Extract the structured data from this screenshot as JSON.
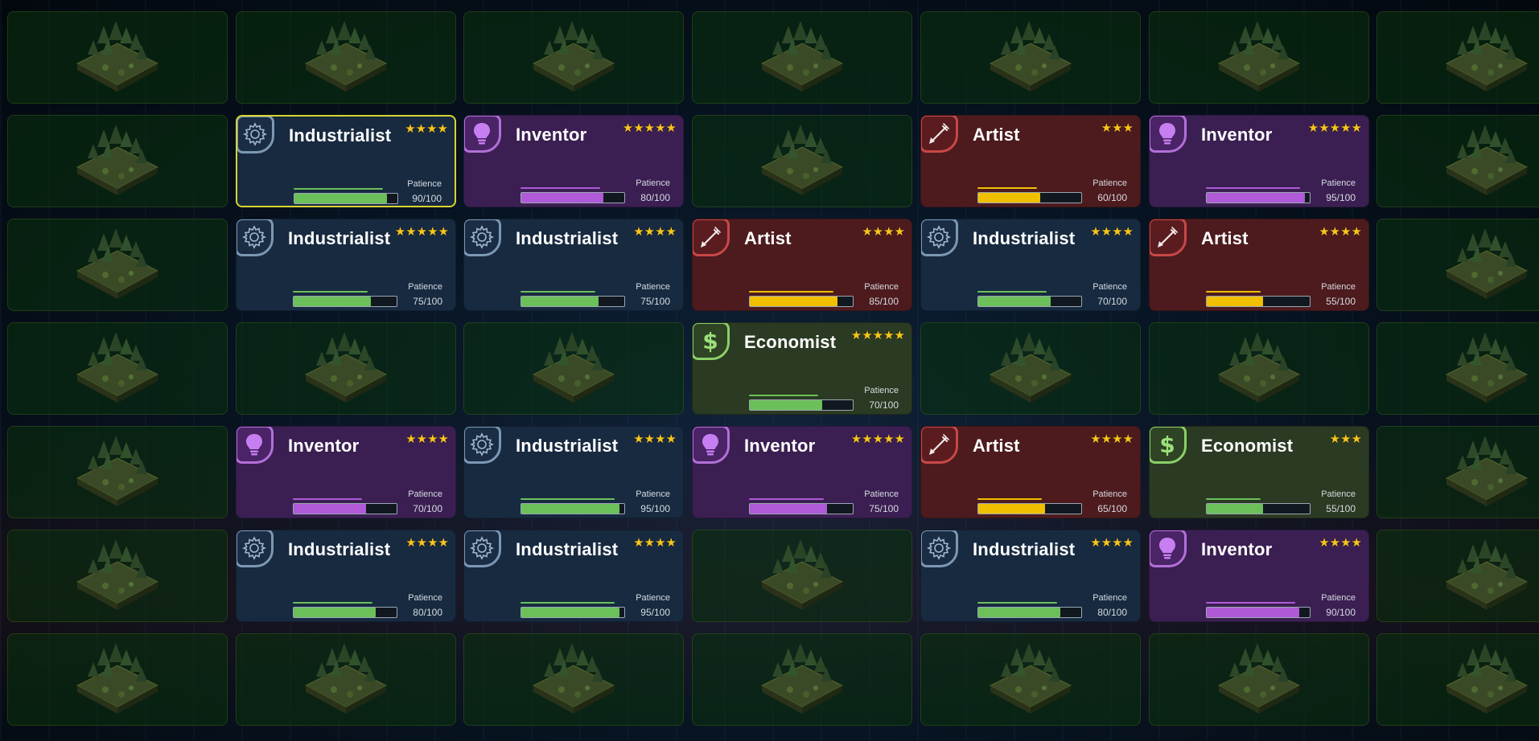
{
  "labels": {
    "patience": "Patience"
  },
  "colors": {
    "bar_fill": {
      "industrialist": "#6cc05a",
      "economist": "#6cc05a",
      "inventor": "#b05ad8",
      "artist": "#f0c000"
    },
    "star": "#f7c51e"
  },
  "grid": {
    "rows": 7,
    "cols": 7,
    "empty_tile_icon": "forest-tile-icon",
    "cards": [
      {
        "row": 1,
        "col": 1,
        "role": "Industrialist",
        "type": "industrialist",
        "icon": "gear-icon",
        "stars": "★★★★",
        "patience": 90,
        "patience_text": "90/100",
        "selected": true
      },
      {
        "row": 1,
        "col": 2,
        "role": "Inventor",
        "type": "inventor",
        "icon": "lightbulb-icon",
        "stars": "★★★★★",
        "patience": 80,
        "patience_text": "80/100"
      },
      {
        "row": 1,
        "col": 4,
        "role": "Artist",
        "type": "artist",
        "icon": "paintbrush-icon",
        "stars": "★★★",
        "patience": 60,
        "patience_text": "60/100"
      },
      {
        "row": 1,
        "col": 5,
        "role": "Inventor",
        "type": "inventor",
        "icon": "lightbulb-icon",
        "stars": "★★★★★",
        "patience": 95,
        "patience_text": "95/100"
      },
      {
        "row": 2,
        "col": 1,
        "role": "Industrialist",
        "type": "industrialist",
        "icon": "gear-icon",
        "stars": "★★★★★",
        "patience": 75,
        "patience_text": "75/100"
      },
      {
        "row": 2,
        "col": 2,
        "role": "Industrialist",
        "type": "industrialist",
        "icon": "gear-icon",
        "stars": "★★★★",
        "patience": 75,
        "patience_text": "75/100"
      },
      {
        "row": 2,
        "col": 3,
        "role": "Artist",
        "type": "artist",
        "icon": "paintbrush-icon",
        "stars": "★★★★",
        "patience": 85,
        "patience_text": "85/100"
      },
      {
        "row": 2,
        "col": 4,
        "role": "Industrialist",
        "type": "industrialist",
        "icon": "gear-icon",
        "stars": "★★★★",
        "patience": 70,
        "patience_text": "70/100"
      },
      {
        "row": 2,
        "col": 5,
        "role": "Artist",
        "type": "artist",
        "icon": "paintbrush-icon",
        "stars": "★★★★",
        "patience": 55,
        "patience_text": "55/100"
      },
      {
        "row": 3,
        "col": 3,
        "role": "Economist",
        "type": "economist",
        "icon": "dollar-icon",
        "stars": "★★★★★",
        "patience": 70,
        "patience_text": "70/100"
      },
      {
        "row": 4,
        "col": 1,
        "role": "Inventor",
        "type": "inventor",
        "icon": "lightbulb-icon",
        "stars": "★★★★",
        "patience": 70,
        "patience_text": "70/100"
      },
      {
        "row": 4,
        "col": 2,
        "role": "Industrialist",
        "type": "industrialist",
        "icon": "gear-icon",
        "stars": "★★★★",
        "patience": 95,
        "patience_text": "95/100"
      },
      {
        "row": 4,
        "col": 3,
        "role": "Inventor",
        "type": "inventor",
        "icon": "lightbulb-icon",
        "stars": "★★★★★",
        "patience": 75,
        "patience_text": "75/100"
      },
      {
        "row": 4,
        "col": 4,
        "role": "Artist",
        "type": "artist",
        "icon": "paintbrush-icon",
        "stars": "★★★★",
        "patience": 65,
        "patience_text": "65/100"
      },
      {
        "row": 4,
        "col": 5,
        "role": "Economist",
        "type": "economist",
        "icon": "dollar-icon",
        "stars": "★★★",
        "patience": 55,
        "patience_text": "55/100"
      },
      {
        "row": 5,
        "col": 1,
        "role": "Industrialist",
        "type": "industrialist",
        "icon": "gear-icon",
        "stars": "★★★★",
        "patience": 80,
        "patience_text": "80/100"
      },
      {
        "row": 5,
        "col": 2,
        "role": "Industrialist",
        "type": "industrialist",
        "icon": "gear-icon",
        "stars": "★★★★",
        "patience": 95,
        "patience_text": "95/100"
      },
      {
        "row": 5,
        "col": 4,
        "role": "Industrialist",
        "type": "industrialist",
        "icon": "gear-icon",
        "stars": "★★★★",
        "patience": 80,
        "patience_text": "80/100"
      },
      {
        "row": 5,
        "col": 5,
        "role": "Inventor",
        "type": "inventor",
        "icon": "lightbulb-icon",
        "stars": "★★★★",
        "patience": 90,
        "patience_text": "90/100"
      }
    ]
  }
}
